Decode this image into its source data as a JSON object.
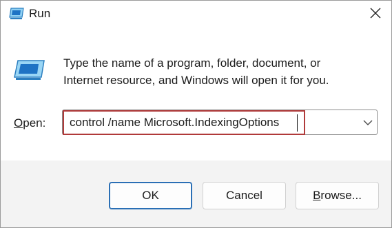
{
  "window": {
    "title": "Run",
    "icon": "run-icon",
    "close_icon": "close-icon"
  },
  "main": {
    "description_line1": "Type the name of a program, folder, document, or",
    "description_line2": "Internet resource, and Windows will open it for you.",
    "icon": "run-icon"
  },
  "open": {
    "label_accel": "O",
    "label_rest": "pen:",
    "value": "control /name Microsoft.IndexingOptions",
    "dropdown_icon": "chevron-down-icon",
    "highlight_color": "#b03a3a"
  },
  "buttons": {
    "ok_label": "OK",
    "cancel_label": "Cancel",
    "browse_accel": "B",
    "browse_rest": "rowse..."
  },
  "colors": {
    "accent": "#2a6fb5",
    "footer_bg": "#f3f3f3"
  }
}
